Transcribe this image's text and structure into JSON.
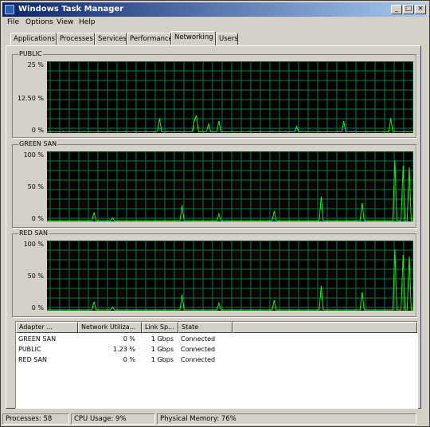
{
  "window": {
    "title": "Windows Task Manager",
    "controls": {
      "minimize": "_",
      "maximize": "□",
      "close": "×"
    }
  },
  "menu": [
    "File",
    "Options",
    "View",
    "Help"
  ],
  "tabs": [
    {
      "label": "Applications",
      "active": false
    },
    {
      "label": "Processes",
      "active": false
    },
    {
      "label": "Services",
      "active": false
    },
    {
      "label": "Performance",
      "active": false
    },
    {
      "label": "Networking",
      "active": true
    },
    {
      "label": "Users",
      "active": false
    }
  ],
  "graphs": [
    {
      "name": "PUBLIC",
      "scale_labels": [
        "25 %",
        "12.50 %",
        "0 %"
      ],
      "max_percent": 25,
      "series": [
        0,
        0.2,
        0.1,
        0.3,
        0.1,
        0.2,
        0.1,
        0.2,
        0.3,
        0.1,
        0.2,
        0.2,
        0.1,
        0.3,
        0.2,
        0.1,
        0.2,
        0.1,
        0.3,
        0.2,
        0.1,
        0.2,
        0.1,
        0.1,
        0.2,
        0.3,
        0.2,
        0.1,
        0.2,
        0.1,
        0.2,
        0.3,
        0.2,
        0.1,
        0.2,
        0.1,
        0.2,
        0.1,
        0.3,
        0.2,
        0.2,
        0.1,
        0.2,
        0.3,
        0.1,
        0.2,
        0.1,
        0.2,
        0.3,
        0.2,
        0.1,
        0.2,
        0.1,
        0.2,
        0.3,
        0.1,
        0.2,
        0.1,
        0.2,
        0.3,
        0.2,
        0.1,
        0.2,
        0.1,
        0.2,
        0.3,
        0.1,
        0.2,
        0.2,
        0.1,
        0.2,
        0.3,
        0.1,
        0.2,
        0.1,
        0.2,
        0.2,
        0.1,
        0.3,
        0.2,
        0.1,
        0.2,
        0.1,
        0.2,
        0.3,
        0.1,
        0.2,
        0.1,
        0.2,
        0.1,
        0.2,
        0.2,
        0.1,
        0.2,
        0.1,
        0.2,
        0.2,
        0.1,
        0.2,
        0.3,
        0.1,
        0.2,
        0.1,
        0.2,
        0.3,
        0.2,
        0.1,
        0.2,
        0.1,
        0.2,
        0.3,
        0.2,
        0.1,
        0.2,
        0.2,
        0.1,
        0.3,
        0.2,
        0.1,
        0.2,
        0.2,
        0.1,
        0.2,
        0.1,
        0.2,
        0.3,
        0.1,
        0.2,
        0.1,
        0.2,
        0.2,
        0.1,
        0.2,
        0.3,
        0.1,
        0.2,
        0.1,
        0.2,
        0.2,
        0.1,
        0.2,
        0.1,
        0.2,
        0.3,
        0.1,
        0.2,
        0.1,
        0.2,
        0.2,
        0.1,
        0.3,
        0.2,
        0.1,
        0.2,
        0.1,
        0.2,
        0.3,
        0.1,
        0.2,
        0.1,
        0.2,
        0.2,
        0.1,
        0.2,
        0.1,
        0.2,
        0.3
      ],
      "spikes": [
        [
          0.31,
          5
        ],
        [
          0.4,
          4
        ],
        [
          0.41,
          6
        ],
        [
          0.44,
          3
        ],
        [
          0.47,
          4
        ],
        [
          0.68,
          2
        ],
        [
          0.81,
          4
        ],
        [
          0.94,
          5
        ]
      ]
    },
    {
      "name": "GREEN SAN",
      "scale_labels": [
        "100 %",
        "50 %",
        "0 %"
      ],
      "max_percent": 100,
      "spikes": [
        [
          0.13,
          12
        ],
        [
          0.18,
          4
        ],
        [
          0.37,
          22
        ],
        [
          0.47,
          10
        ],
        [
          0.62,
          14
        ],
        [
          0.75,
          35
        ],
        [
          0.86,
          26
        ],
        [
          0.95,
          88
        ],
        [
          0.97,
          80
        ],
        [
          0.99,
          78
        ]
      ]
    },
    {
      "name": "RED SAN",
      "scale_labels": [
        "100 %",
        "50 %",
        "0 %"
      ],
      "max_percent": 100,
      "spikes": [
        [
          0.13,
          12
        ],
        [
          0.18,
          4
        ],
        [
          0.37,
          22
        ],
        [
          0.47,
          10
        ],
        [
          0.62,
          14
        ],
        [
          0.75,
          35
        ],
        [
          0.86,
          26
        ],
        [
          0.95,
          88
        ],
        [
          0.97,
          80
        ],
        [
          0.99,
          78
        ]
      ]
    }
  ],
  "adapter_table": {
    "columns": [
      "Adapter ...",
      "Network Utiliza...",
      "Link Sp...",
      "State"
    ],
    "rows": [
      [
        "GREEN SAN",
        "0 %",
        "1 Gbps",
        "Connected"
      ],
      [
        "PUBLIC",
        "1.23 %",
        "1 Gbps",
        "Connected"
      ],
      [
        "RED SAN",
        "0 %",
        "1 Gbps",
        "Connected"
      ]
    ]
  },
  "status": {
    "processes": "Processes: 58",
    "cpu": "CPU Usage: 9%",
    "memory": "Physical Memory: 76%"
  },
  "colors": {
    "graph_bg": "#000000",
    "grid": "#008040",
    "trace": "#00ff00"
  }
}
